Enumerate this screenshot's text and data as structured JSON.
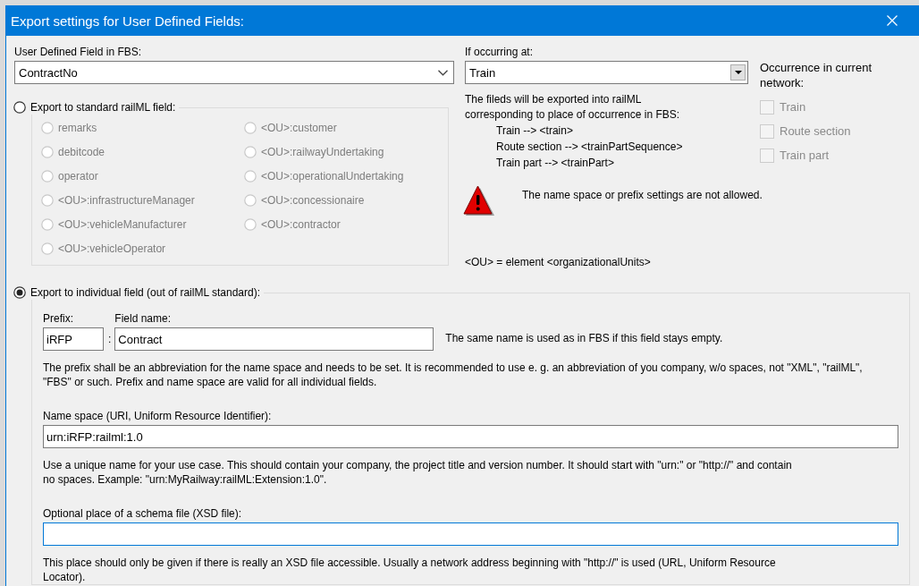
{
  "window": {
    "title": "Export settings for User Defined Fields:"
  },
  "udf_field": {
    "label": "User Defined Field in FBS:",
    "value": "ContractNo"
  },
  "standard_export": {
    "label": "Export to standard railML field:",
    "selected": false,
    "fields": [
      {
        "label": "remarks",
        "selected": false,
        "disabled": true
      },
      {
        "label": "<OU>:customer",
        "selected": false,
        "disabled": true
      },
      {
        "label": "debitcode",
        "selected": false,
        "disabled": true
      },
      {
        "label": "<OU>:railwayUndertaking",
        "selected": false,
        "disabled": true
      },
      {
        "label": "operator",
        "selected": false,
        "disabled": true
      },
      {
        "label": "<OU>:operationalUndertaking",
        "selected": false,
        "disabled": true
      },
      {
        "label": "<OU>:infrastructureManager",
        "selected": false,
        "disabled": true
      },
      {
        "label": "<OU>:concessionaire",
        "selected": false,
        "disabled": true
      },
      {
        "label": "<OU>:vehicleManufacturer",
        "selected": false,
        "disabled": true
      },
      {
        "label": "<OU>:contractor",
        "selected": false,
        "disabled": true
      },
      {
        "label": "<OU>:vehicleOperator",
        "selected": false,
        "disabled": true
      }
    ]
  },
  "occurrence": {
    "label": "If occurring at:",
    "value": "Train",
    "description": [
      "The fileds will be exported into railML",
      "corresponding to place of occurrence in FBS:"
    ],
    "mappings": [
      "Train --> <train>",
      "Route section --> <trainPartSequence>",
      "Train part --> <trainPart>"
    ],
    "warning": "The name space or prefix settings are not allowed.",
    "legend": "<OU> = element <organizationalUnits>"
  },
  "current_network": {
    "label": "Occurrence in current network:",
    "items": [
      {
        "label": "Train",
        "checked": false,
        "disabled": true
      },
      {
        "label": "Route section",
        "checked": false,
        "disabled": true
      },
      {
        "label": "Train part",
        "checked": false,
        "disabled": true
      }
    ]
  },
  "individual_export": {
    "label": "Export to individual field (out of railML standard):",
    "selected": true,
    "prefix": {
      "label": "Prefix:",
      "value": "iRFP"
    },
    "separator": ":",
    "field_name": {
      "label": "Field name:",
      "value": "Contract"
    },
    "field_name_hint": "The same name is used as in FBS if this field stays empty.",
    "prefix_note": "The prefix shall be an abbreviation for the name space and needs to be set. It is recommended to use e. g. an abbreviation of you company, w/o spaces, not \"XML\", \"railML\", \"FBS\" or such. Prefix and name space are valid for all individual fields.",
    "namespace": {
      "label": "Name space (URI, Uniform Resource Identifier):",
      "value": "urn:iRFP:railml:1.0",
      "focused": false,
      "note": "Use a unique name for your use case. This should contain your company, the project title and version number. It should start with \"urn:\" or \"http://\" and contain no spaces. Example: \"urn:MyRailway:railML:Extension:1.0\"."
    },
    "schema_file": {
      "label": "Optional place of a schema file (XSD file):",
      "focused": true,
      "note": "This place should only be given if there is really an XSD file accessible. Usually a network address beginning with \"http://\" is used (URL, Uniform Resource Locator)."
    }
  }
}
